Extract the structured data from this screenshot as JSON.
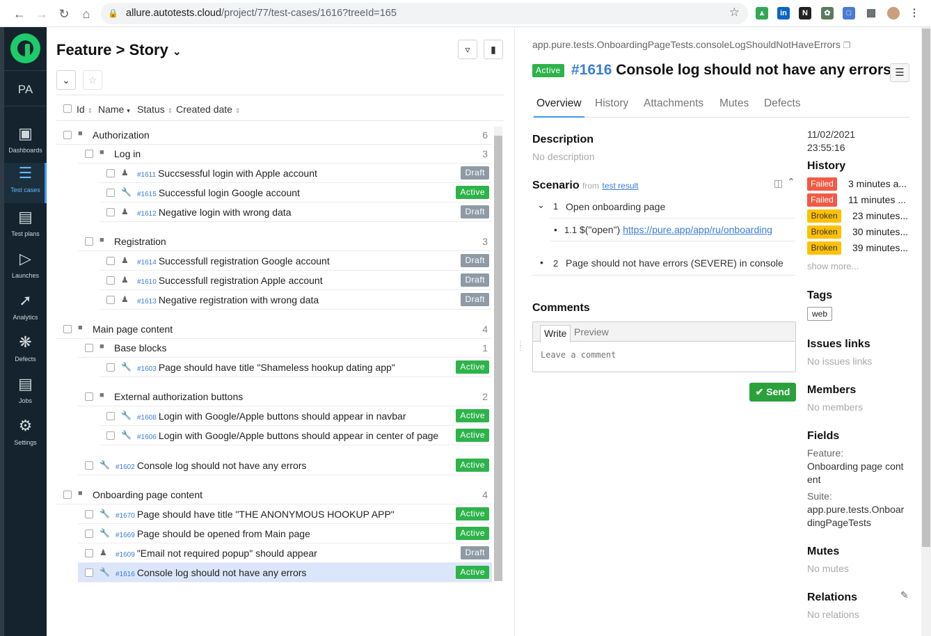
{
  "browser": {
    "url_host": "allure.autotests.cloud",
    "url_path": "/project/77/test-cases/1616?treeId=165"
  },
  "sidebar": {
    "project_initials": "PA",
    "items": [
      {
        "label": "Dashboards"
      },
      {
        "label": "Test cases"
      },
      {
        "label": "Test plans"
      },
      {
        "label": "Launches"
      },
      {
        "label": "Analytics"
      },
      {
        "label": "Defects"
      },
      {
        "label": "Jobs"
      },
      {
        "label": "Settings"
      }
    ]
  },
  "tree_header": {
    "feature": "Feature",
    "separator": ">",
    "story": "Story",
    "columns": [
      "Id",
      "Name",
      "Status",
      "Created date"
    ]
  },
  "tree": {
    "groups": [
      {
        "name": "Authorization",
        "count": "6"
      },
      {
        "name": "Log in",
        "count": "3"
      },
      {
        "name": "Registration",
        "count": "3"
      },
      {
        "name": "Main page content",
        "count": "4"
      },
      {
        "name": "Base blocks",
        "count": "1"
      },
      {
        "name": "External authorization buttons",
        "count": "2"
      },
      {
        "name": "Onboarding page content",
        "count": "4"
      }
    ],
    "cases": [
      {
        "id": "#1611",
        "title": "Succsessful login with Apple account",
        "status": "Draft"
      },
      {
        "id": "#1615",
        "title": "Successful login Google account",
        "status": "Active"
      },
      {
        "id": "#1612",
        "title": "Negative login with wrong data",
        "status": "Draft"
      },
      {
        "id": "#1614",
        "title": "Successfull registration Google account",
        "status": "Draft"
      },
      {
        "id": "#1610",
        "title": "Successfull registration Apple account",
        "status": "Draft"
      },
      {
        "id": "#1613",
        "title": "Negative registration with wrong data",
        "status": "Draft"
      },
      {
        "id": "#1603",
        "title": "Page should have title \"Shameless hookup dating app\"",
        "status": "Active"
      },
      {
        "id": "#1608",
        "title": "Login with Google/Apple buttons should appear in navbar",
        "status": "Active"
      },
      {
        "id": "#1606",
        "title": "Login with Google/Apple buttons should appear in center of page",
        "status": "Active"
      },
      {
        "id": "#1602",
        "title": "Console log should not have any errors",
        "status": "Active"
      },
      {
        "id": "#1670",
        "title": "Page should have title \"THE ANONYMOUS HOOKUP APP\"",
        "status": "Active"
      },
      {
        "id": "#1669",
        "title": "Page should be opened from Main page",
        "status": "Active"
      },
      {
        "id": "#1609",
        "title": "\"Email not required popup\" should appear",
        "status": "Draft"
      },
      {
        "id": "#1616",
        "title": "Console log should not have any errors",
        "status": "Active"
      }
    ]
  },
  "detail": {
    "path": "app.pure.tests.OnboardingPageTests.consoleLogShouldNotHaveErrors",
    "status": "Active",
    "number": "#1616",
    "title": "Console log should not have any errors",
    "tabs": [
      "Overview",
      "History",
      "Attachments",
      "Mutes",
      "Defects"
    ],
    "description_heading": "Description",
    "description_empty": "No description",
    "scenario_heading": "Scenario",
    "scenario_from": "from",
    "scenario_link": "test result",
    "steps": [
      {
        "num": "1",
        "text": "Open onboarding page"
      },
      {
        "num": "1.1",
        "text_prefix": "$(\"open\")",
        "link": "https://pure.app/app/ru/onboarding"
      },
      {
        "num": "2",
        "text": "Page should not have errors (SEVERE) in console"
      }
    ],
    "comments_heading": "Comments",
    "comment_write_tab": "Write",
    "comment_preview_tab": "Preview",
    "comment_placeholder": "Leave a comment",
    "send_label": "Send",
    "created_date": "11/02/2021",
    "created_time": "23:55:16",
    "history_heading": "History",
    "history": [
      {
        "status": "Failed",
        "time": "3 minutes a..."
      },
      {
        "status": "Failed",
        "time": "11 minutes ..."
      },
      {
        "status": "Broken",
        "time": "23 minutes..."
      },
      {
        "status": "Broken",
        "time": "30 minutes..."
      },
      {
        "status": "Broken",
        "time": "39 minutes..."
      }
    ],
    "show_more": "show more...",
    "tags_heading": "Tags",
    "tag": "web",
    "issues_heading": "Issues links",
    "issues_empty": "No issues links",
    "members_heading": "Members",
    "members_empty": "No members",
    "fields_heading": "Fields",
    "feature_label": "Feature:",
    "feature_value_1": "Onboarding page cont",
    "feature_value_2": "ent",
    "suite_label": "Suite:",
    "suite_value_1": "app.pure.tests.Onboar",
    "suite_value_2": "dingPageTests",
    "mutes_heading": "Mutes",
    "mutes_empty": "No mutes",
    "relations_heading": "Relations",
    "relations_empty": "No relations"
  },
  "colors": {
    "active": "#2eb34b",
    "draft": "#8e9ba6",
    "failed": "#f15a45",
    "broken": "#ffc107",
    "sidebar": "#14232d",
    "accent": "#3b98f5"
  }
}
